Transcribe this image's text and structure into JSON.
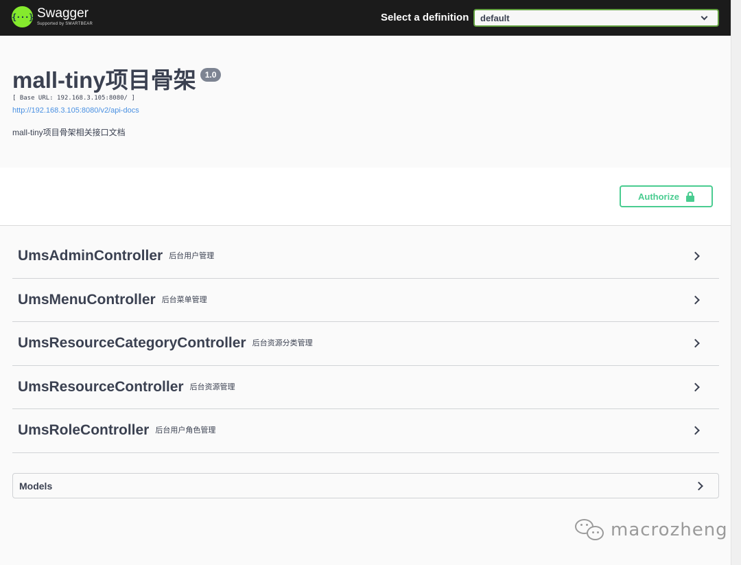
{
  "topbar": {
    "brand_logo_glyph": "{···}",
    "brand_name": "Swagger",
    "brand_sub": "Supported by SMARTBEAR",
    "definition_label": "Select a definition",
    "definition_value": "default"
  },
  "info": {
    "title": "mall-tiny项目骨架",
    "version": "1.0",
    "base_url": "[ Base URL: 192.168.3.105:8080/ ]",
    "api_docs_link": "http://192.168.3.105:8080/v2/api-docs",
    "description": "mall-tiny项目骨架相关接口文档"
  },
  "schemes": {
    "authorize_label": "Authorize"
  },
  "tags": [
    {
      "name": "UmsAdminController",
      "description": "后台用户管理"
    },
    {
      "name": "UmsMenuController",
      "description": "后台菜单管理"
    },
    {
      "name": "UmsResourceCategoryController",
      "description": "后台资源分类管理"
    },
    {
      "name": "UmsResourceController",
      "description": "后台资源管理"
    },
    {
      "name": "UmsRoleController",
      "description": "后台用户角色管理"
    }
  ],
  "models": {
    "label": "Models"
  },
  "watermark": {
    "text": "macrozheng"
  },
  "colors": {
    "topbar_bg": "#1b1b1b",
    "brand_green": "#85ea2d",
    "select_border": "#62a03f",
    "authorize_green": "#49cc90",
    "link_blue": "#4990e2",
    "text": "#3b4151",
    "version_badge": "#7d8492"
  },
  "icons": {
    "brand": "swagger-logo-icon",
    "select": "chevron-down-icon",
    "authorize": "lock-icon",
    "expand": "chevron-right-icon",
    "watermark": "wechat-icon"
  }
}
